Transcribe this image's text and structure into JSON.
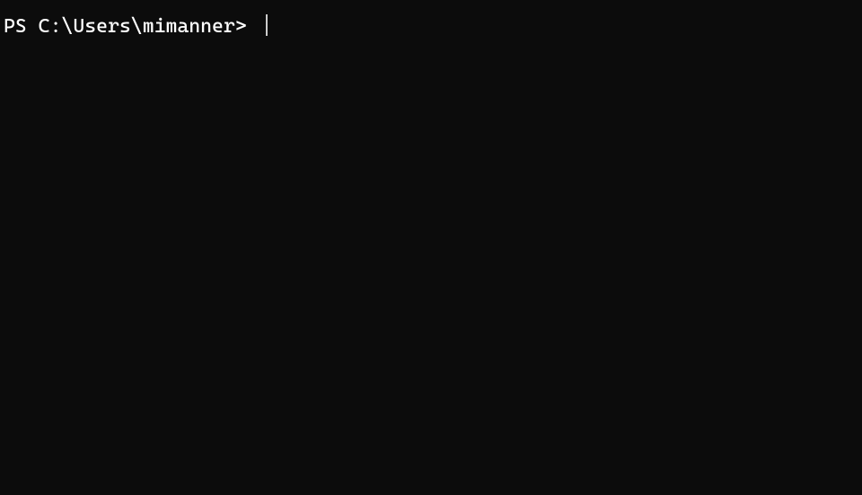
{
  "terminal": {
    "prompt": "PS C:\\Users\\mimanner> "
  }
}
